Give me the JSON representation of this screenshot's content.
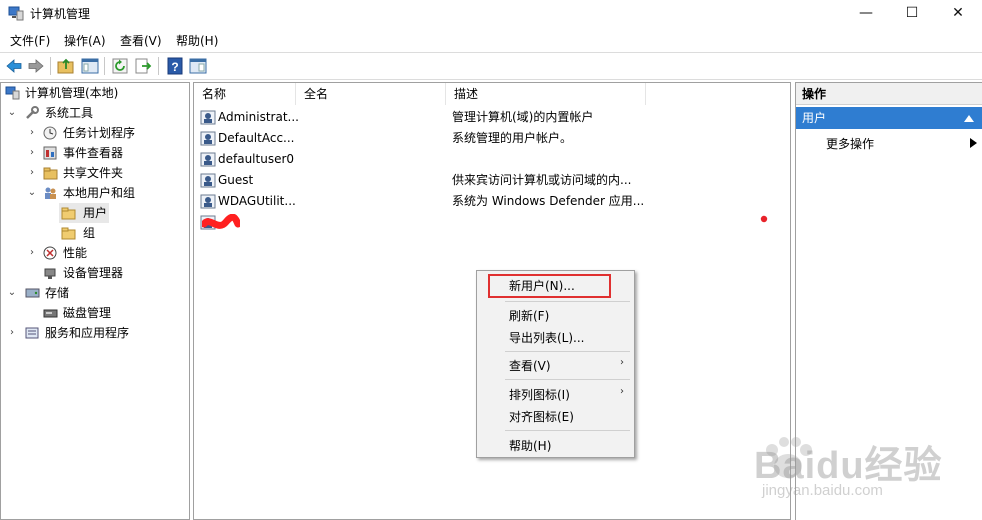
{
  "window": {
    "title": "计算机管理",
    "controls": {
      "minimize": "—",
      "maximize": "☐",
      "close": "✕"
    }
  },
  "menubar": [
    "文件(F)",
    "操作(A)",
    "查看(V)",
    "帮助(H)"
  ],
  "tree": {
    "root": "计算机管理(本地)",
    "system_tools": "系统工具",
    "task_scheduler": "任务计划程序",
    "event_viewer": "事件查看器",
    "shared_folders": "共享文件夹",
    "local_users_groups": "本地用户和组",
    "users": "用户",
    "groups": "组",
    "performance": "性能",
    "device_manager": "设备管理器",
    "storage": "存储",
    "disk_management": "磁盘管理",
    "services_apps": "服务和应用程序"
  },
  "list": {
    "columns": [
      "名称",
      "全名",
      "描述"
    ],
    "rows": [
      {
        "name": "Administrat...",
        "full": "",
        "desc": "管理计算机(域)的内置帐户"
      },
      {
        "name": "DefaultAcc...",
        "full": "",
        "desc": "系统管理的用户帐户。"
      },
      {
        "name": "defaultuser0",
        "full": "",
        "desc": ""
      },
      {
        "name": "Guest",
        "full": "",
        "desc": "供来宾访问计算机或访问域的内..."
      },
      {
        "name": "WDAGUtilit...",
        "full": "",
        "desc": "系统为 Windows Defender 应用..."
      }
    ]
  },
  "actions": {
    "header": "操作",
    "section": "用户",
    "more": "更多操作"
  },
  "context_menu": {
    "new_user": "新用户(N)...",
    "refresh": "刷新(F)",
    "export": "导出列表(L)...",
    "view": "查看(V)",
    "arrange": "排列图标(I)",
    "align": "对齐图标(E)",
    "help": "帮助(H)"
  },
  "watermark": {
    "brand": "Baidu经验",
    "url": "jingyan.baidu.com"
  },
  "colors": {
    "selection_blue": "#2f7dd1",
    "highlight_red": "#e03030",
    "annotation_dot": "#e8222a",
    "redaction": "#ff2020"
  }
}
